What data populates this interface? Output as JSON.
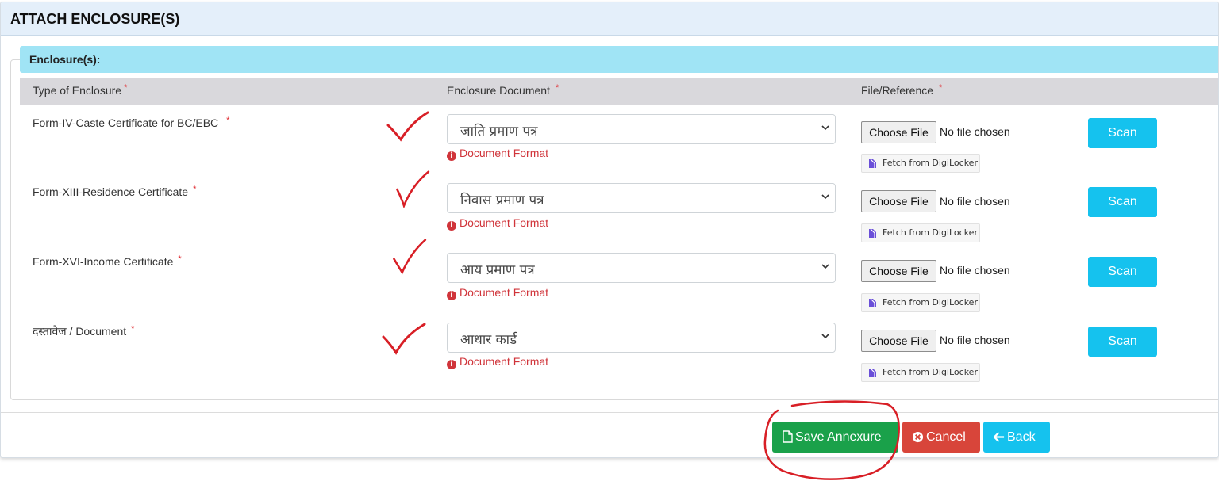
{
  "header": {
    "title": "ATTACH ENCLOSURE(S)"
  },
  "panel": {
    "heading": "Enclosure(s):"
  },
  "table": {
    "columns": [
      "Type of Enclosure",
      "Enclosure Document",
      "File/Reference"
    ],
    "required_mark": "*",
    "rows": [
      {
        "type": "Form-IV-Caste Certificate for BC/EBC",
        "document": "जाति प्रमाण पत्र",
        "format_label": "Document Format",
        "choose_label": "Choose File",
        "file_status": "No file chosen",
        "digilocker_label": "Fetch from DigiLocker",
        "scan_label": "Scan"
      },
      {
        "type": "Form-XIII-Residence Certificate",
        "document": "निवास प्रमाण पत्र",
        "format_label": "Document Format",
        "choose_label": "Choose File",
        "file_status": "No file chosen",
        "digilocker_label": "Fetch from DigiLocker",
        "scan_label": "Scan"
      },
      {
        "type": "Form-XVI-Income Certificate",
        "document": "आय प्रमाण पत्र",
        "format_label": "Document Format",
        "choose_label": "Choose File",
        "file_status": "No file chosen",
        "digilocker_label": "Fetch from DigiLocker",
        "scan_label": "Scan"
      },
      {
        "type": "दस्तावेज / Document",
        "document": "आधार कार्ड",
        "format_label": "Document Format",
        "choose_label": "Choose File",
        "file_status": "No file chosen",
        "digilocker_label": "Fetch from DigiLocker",
        "scan_label": "Scan"
      }
    ]
  },
  "actions": {
    "save_label": "Save Annexure",
    "cancel_label": "Cancel",
    "back_label": "Back"
  },
  "colors": {
    "save": "#1aa14a",
    "cancel": "#d8453a",
    "scan": "#15c2ee",
    "heading_bg": "#a0e4f5",
    "annotation": "#d81f26"
  },
  "icons": {
    "info": "info-circle-icon",
    "document": "document-icon",
    "cancel": "times-circle-icon",
    "back": "arrow-left-icon",
    "digilocker": "digilocker-icon",
    "caret": "chevron-down-icon"
  }
}
